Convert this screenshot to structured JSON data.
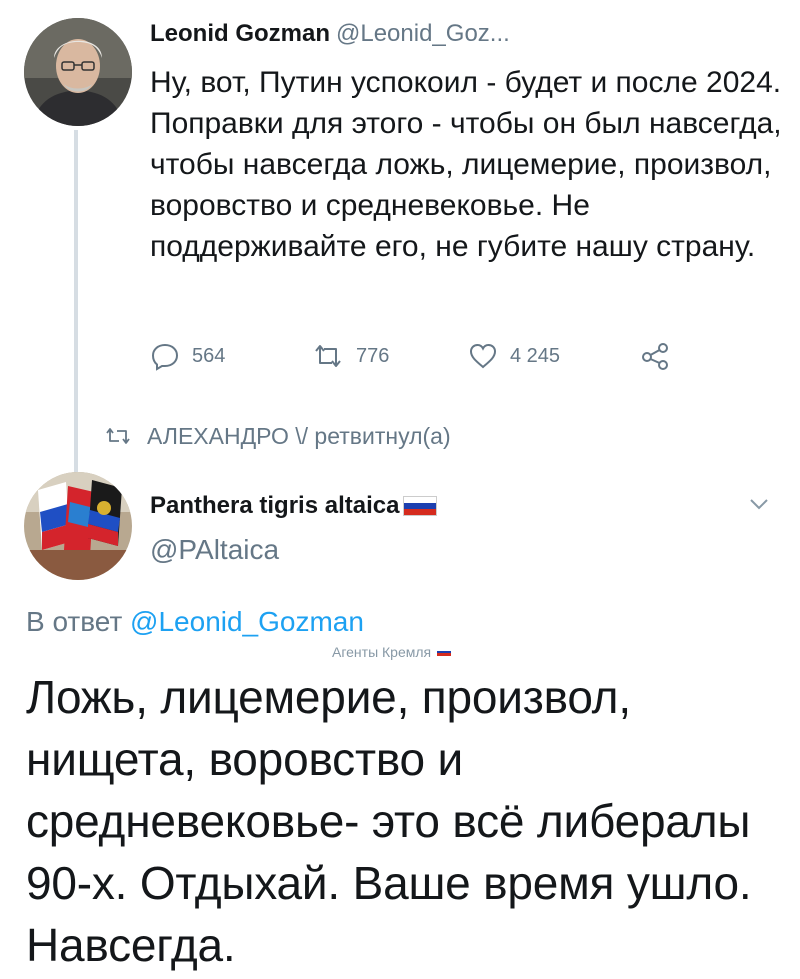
{
  "tweet1": {
    "author_name": "Leonid Gozman",
    "author_handle": "@Leonid_Goz...",
    "text": "Ну, вот, Путин успокоил - будет и после 2024. Поправки для этого - чтобы он был навсегда, чтобы навсегда ложь, лицемерие, произвол, воровство и средневековье. Не поддерживайте его, не губите нашу страну.",
    "actions": {
      "reply_count": "564",
      "retweet_count": "776",
      "like_count": "4 245",
      "reply_icon": "reply-icon",
      "retweet_icon": "retweet-icon",
      "like_icon": "heart-icon",
      "share_icon": "share-icon"
    }
  },
  "retweet_notice": {
    "text": "АЛЕХАНДРО \\/ ретвитнул(а)",
    "icon": "retweet-icon"
  },
  "tweet2": {
    "author_name": "Panthera tigris altaica",
    "author_handle": "@PAltaica",
    "name_flag": "russian-flag",
    "reply_prefix": "В ответ",
    "reply_mention": "@Leonid_Gozman",
    "watermark": "Агенты Кремля",
    "text": "Ложь, лицемерие, произвол, нищета, воровство и средневековье- это всё либералы 90-х. Отдыхай. Ваше время ушло. Навсегда.",
    "menu_icon": "chevron-down-icon"
  },
  "colors": {
    "text": "#14171a",
    "secondary": "#657786",
    "link": "#1da1f2",
    "thread_line": "#d6dde3"
  }
}
